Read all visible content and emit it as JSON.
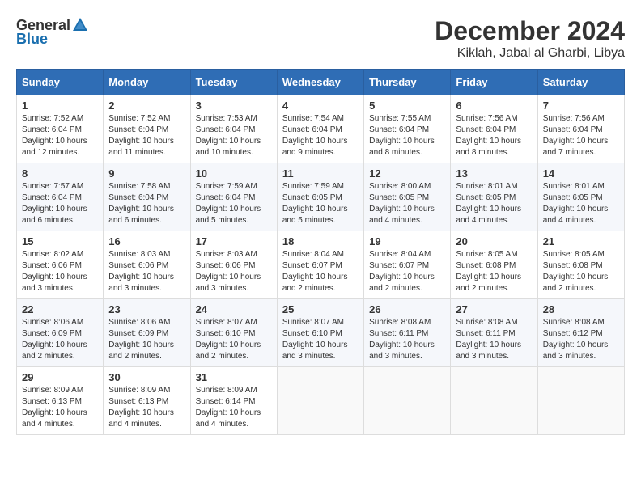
{
  "header": {
    "logo_general": "General",
    "logo_blue": "Blue",
    "month_title": "December 2024",
    "location": "Kiklah, Jabal al Gharbi, Libya"
  },
  "weekdays": [
    "Sunday",
    "Monday",
    "Tuesday",
    "Wednesday",
    "Thursday",
    "Friday",
    "Saturday"
  ],
  "weeks": [
    [
      {
        "day": "1",
        "sunrise": "7:52 AM",
        "sunset": "6:04 PM",
        "daylight": "10 hours and 12 minutes."
      },
      {
        "day": "2",
        "sunrise": "7:52 AM",
        "sunset": "6:04 PM",
        "daylight": "10 hours and 11 minutes."
      },
      {
        "day": "3",
        "sunrise": "7:53 AM",
        "sunset": "6:04 PM",
        "daylight": "10 hours and 10 minutes."
      },
      {
        "day": "4",
        "sunrise": "7:54 AM",
        "sunset": "6:04 PM",
        "daylight": "10 hours and 9 minutes."
      },
      {
        "day": "5",
        "sunrise": "7:55 AM",
        "sunset": "6:04 PM",
        "daylight": "10 hours and 8 minutes."
      },
      {
        "day": "6",
        "sunrise": "7:56 AM",
        "sunset": "6:04 PM",
        "daylight": "10 hours and 8 minutes."
      },
      {
        "day": "7",
        "sunrise": "7:56 AM",
        "sunset": "6:04 PM",
        "daylight": "10 hours and 7 minutes."
      }
    ],
    [
      {
        "day": "8",
        "sunrise": "7:57 AM",
        "sunset": "6:04 PM",
        "daylight": "10 hours and 6 minutes."
      },
      {
        "day": "9",
        "sunrise": "7:58 AM",
        "sunset": "6:04 PM",
        "daylight": "10 hours and 6 minutes."
      },
      {
        "day": "10",
        "sunrise": "7:59 AM",
        "sunset": "6:04 PM",
        "daylight": "10 hours and 5 minutes."
      },
      {
        "day": "11",
        "sunrise": "7:59 AM",
        "sunset": "6:05 PM",
        "daylight": "10 hours and 5 minutes."
      },
      {
        "day": "12",
        "sunrise": "8:00 AM",
        "sunset": "6:05 PM",
        "daylight": "10 hours and 4 minutes."
      },
      {
        "day": "13",
        "sunrise": "8:01 AM",
        "sunset": "6:05 PM",
        "daylight": "10 hours and 4 minutes."
      },
      {
        "day": "14",
        "sunrise": "8:01 AM",
        "sunset": "6:05 PM",
        "daylight": "10 hours and 4 minutes."
      }
    ],
    [
      {
        "day": "15",
        "sunrise": "8:02 AM",
        "sunset": "6:06 PM",
        "daylight": "10 hours and 3 minutes."
      },
      {
        "day": "16",
        "sunrise": "8:03 AM",
        "sunset": "6:06 PM",
        "daylight": "10 hours and 3 minutes."
      },
      {
        "day": "17",
        "sunrise": "8:03 AM",
        "sunset": "6:06 PM",
        "daylight": "10 hours and 3 minutes."
      },
      {
        "day": "18",
        "sunrise": "8:04 AM",
        "sunset": "6:07 PM",
        "daylight": "10 hours and 2 minutes."
      },
      {
        "day": "19",
        "sunrise": "8:04 AM",
        "sunset": "6:07 PM",
        "daylight": "10 hours and 2 minutes."
      },
      {
        "day": "20",
        "sunrise": "8:05 AM",
        "sunset": "6:08 PM",
        "daylight": "10 hours and 2 minutes."
      },
      {
        "day": "21",
        "sunrise": "8:05 AM",
        "sunset": "6:08 PM",
        "daylight": "10 hours and 2 minutes."
      }
    ],
    [
      {
        "day": "22",
        "sunrise": "8:06 AM",
        "sunset": "6:09 PM",
        "daylight": "10 hours and 2 minutes."
      },
      {
        "day": "23",
        "sunrise": "8:06 AM",
        "sunset": "6:09 PM",
        "daylight": "10 hours and 2 minutes."
      },
      {
        "day": "24",
        "sunrise": "8:07 AM",
        "sunset": "6:10 PM",
        "daylight": "10 hours and 2 minutes."
      },
      {
        "day": "25",
        "sunrise": "8:07 AM",
        "sunset": "6:10 PM",
        "daylight": "10 hours and 3 minutes."
      },
      {
        "day": "26",
        "sunrise": "8:08 AM",
        "sunset": "6:11 PM",
        "daylight": "10 hours and 3 minutes."
      },
      {
        "day": "27",
        "sunrise": "8:08 AM",
        "sunset": "6:11 PM",
        "daylight": "10 hours and 3 minutes."
      },
      {
        "day": "28",
        "sunrise": "8:08 AM",
        "sunset": "6:12 PM",
        "daylight": "10 hours and 3 minutes."
      }
    ],
    [
      {
        "day": "29",
        "sunrise": "8:09 AM",
        "sunset": "6:13 PM",
        "daylight": "10 hours and 4 minutes."
      },
      {
        "day": "30",
        "sunrise": "8:09 AM",
        "sunset": "6:13 PM",
        "daylight": "10 hours and 4 minutes."
      },
      {
        "day": "31",
        "sunrise": "8:09 AM",
        "sunset": "6:14 PM",
        "daylight": "10 hours and 4 minutes."
      },
      null,
      null,
      null,
      null
    ]
  ]
}
